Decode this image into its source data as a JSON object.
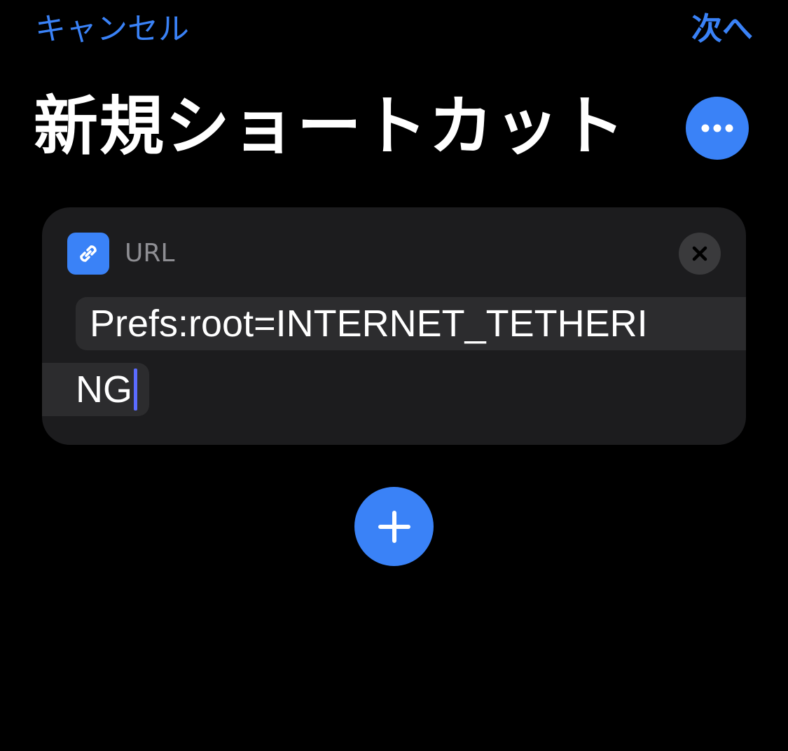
{
  "nav": {
    "cancel_label": "キャンセル",
    "next_label": "次へ"
  },
  "header": {
    "title": "新規ショートカット",
    "more_icon": "ellipsis-icon"
  },
  "action": {
    "icon": "link-icon",
    "label": "URL",
    "remove_icon": "close-icon",
    "url_value_line1": "Prefs:root=INTERNET_TETHERI",
    "url_value_line2": "NG"
  },
  "add_action": {
    "icon": "plus-icon"
  },
  "colors": {
    "accent": "#3a82f7",
    "background": "#000000",
    "card": "#1c1c1e",
    "token": "#2c2c2e",
    "cursor": "#5a6bff"
  }
}
